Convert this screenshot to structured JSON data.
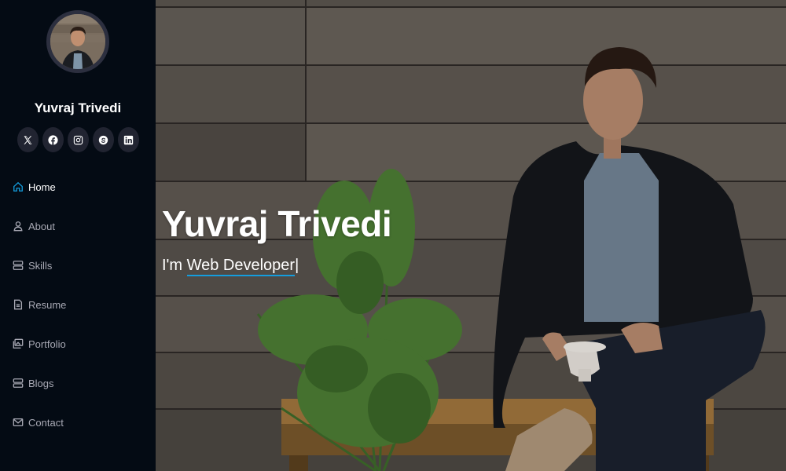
{
  "profile": {
    "name": "Yuvraj Trivedi"
  },
  "social": [
    {
      "name": "x-twitter",
      "glyph": "X"
    },
    {
      "name": "facebook",
      "glyph": "f"
    },
    {
      "name": "instagram",
      "glyph": "ig"
    },
    {
      "name": "skype",
      "glyph": "S"
    },
    {
      "name": "linkedin",
      "glyph": "in"
    }
  ],
  "nav": {
    "items": [
      {
        "label": "Home",
        "icon": "home-icon",
        "active": true
      },
      {
        "label": "About",
        "icon": "person-icon"
      },
      {
        "label": "Skills",
        "icon": "server-icon"
      },
      {
        "label": "Resume",
        "icon": "file-icon"
      },
      {
        "label": "Portfolio",
        "icon": "images-icon"
      },
      {
        "label": "Blogs",
        "icon": "server-icon"
      },
      {
        "label": "Contact",
        "icon": "envelope-icon"
      }
    ]
  },
  "hero": {
    "title": "Yuvraj Trivedi",
    "subtitle_prefix": "I'm ",
    "subtitle_typed": "Web Developer",
    "cursor": "|"
  },
  "colors": {
    "accent": "#149ddd",
    "sidebar_bg": "#040b14",
    "social_bg": "#212431"
  }
}
